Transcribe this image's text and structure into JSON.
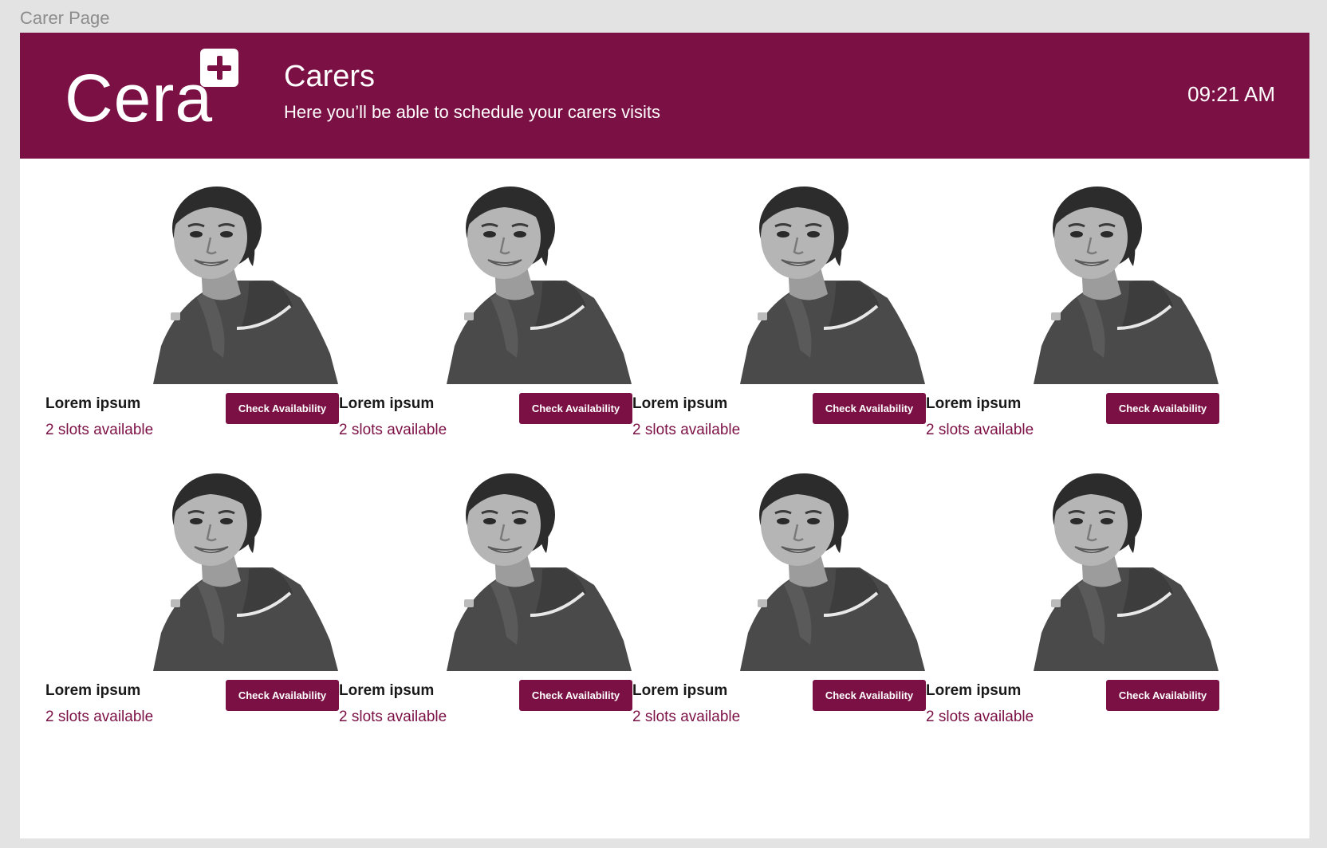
{
  "frame": {
    "label": "Carer Page"
  },
  "header": {
    "logo_text": "Cera",
    "title": "Carers",
    "subtitle": "Here you’ll be able to schedule your carers visits",
    "time": "09:21 AM"
  },
  "colors": {
    "brand": "#7b1044",
    "text_dark": "#1a1a1a",
    "background": "#ffffff"
  },
  "carers": [
    {
      "name": "Lorem ipsum",
      "slots": "2 slots available",
      "button_label": "Check Availability"
    },
    {
      "name": "Lorem ipsum",
      "slots": "2 slots available",
      "button_label": "Check Availability"
    },
    {
      "name": "Lorem ipsum",
      "slots": "2 slots available",
      "button_label": "Check Availability"
    },
    {
      "name": "Lorem ipsum",
      "slots": "2 slots available",
      "button_label": "Check Availability"
    },
    {
      "name": "Lorem ipsum",
      "slots": "2 slots available",
      "button_label": "Check Availability"
    },
    {
      "name": "Lorem ipsum",
      "slots": "2 slots available",
      "button_label": "Check Availability"
    },
    {
      "name": "Lorem ipsum",
      "slots": "2 slots available",
      "button_label": "Check Availability"
    },
    {
      "name": "Lorem ipsum",
      "slots": "2 slots available",
      "button_label": "Check Availability"
    }
  ]
}
